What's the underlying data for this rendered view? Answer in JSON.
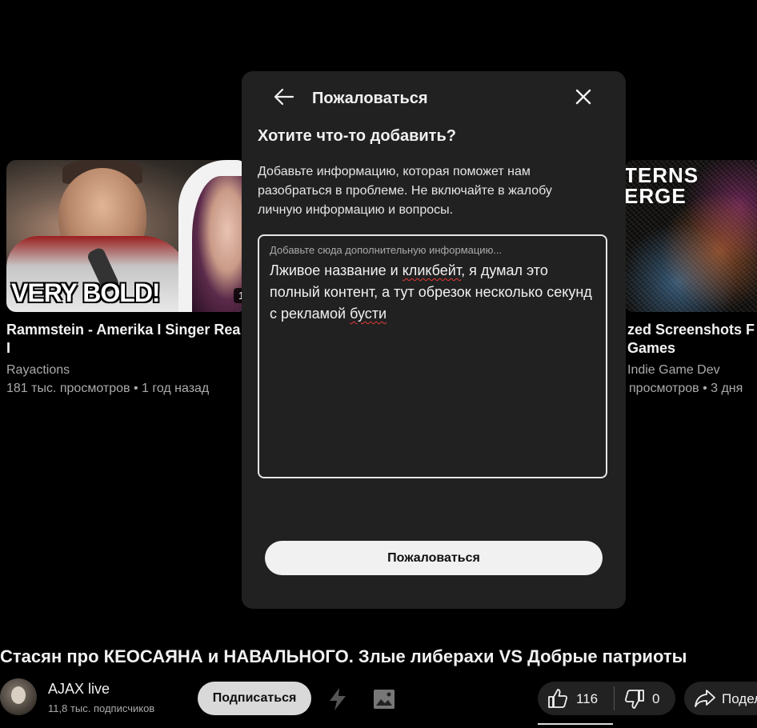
{
  "background": {
    "cards": [
      {
        "thumb_text": "VERY BOLD!",
        "duration": "1",
        "title_line1": "Rammstein - Amerika I Singer Rea",
        "title_line2": "I",
        "channel": "Rayactions",
        "meta": "181 тыс. просмотров • 1 год назад"
      },
      {
        "thumb_text_line1": "TERNS",
        "thumb_text_line2": "ERGE",
        "title_line1": "zed Screenshots F",
        "title_line2": "Games",
        "channel": "Indie Game Dev",
        "meta": "просмотров • 3 дня"
      }
    ]
  },
  "video": {
    "title": "Стасян про КЕОСАЯНА и НАВАЛЬНОГО. Злые либерахи VS Добрые патриоты",
    "channel_name": "AJAX live",
    "subscribers": "11,8 тыс. подписчиков",
    "subscribe_label": "Подписаться",
    "like_count": "116",
    "dislike_count": "0",
    "share_label": "Подел"
  },
  "modal": {
    "title": "Пожаловаться",
    "question": "Хотите что-то добавить?",
    "description": "Добавьте информацию, которая поможет нам разобраться в проблеме. Не включайте в жалобу личную информацию и вопросы.",
    "textarea": {
      "placeholder": "Добавьте сюда дополнительную информацию...",
      "value_part1": "Лживое название и ",
      "value_misspelled1": "кликбейт",
      "value_part2": ", я думал это полный контент, а тут обрезок несколько секунд с рекламой ",
      "value_misspelled2": "бусти"
    },
    "submit_label": "Пожаловаться"
  },
  "icons": {
    "back": "arrow-left-icon",
    "close": "close-icon",
    "premium": "lightning-icon",
    "image": "image-icon",
    "like": "thumbs-up-icon",
    "dislike": "thumbs-down-icon",
    "share": "share-icon"
  },
  "colors": {
    "modal_bg": "#212121",
    "page_bg": "#000000",
    "button_light": "#f1f1f1",
    "spellcheck": "#e53935"
  }
}
